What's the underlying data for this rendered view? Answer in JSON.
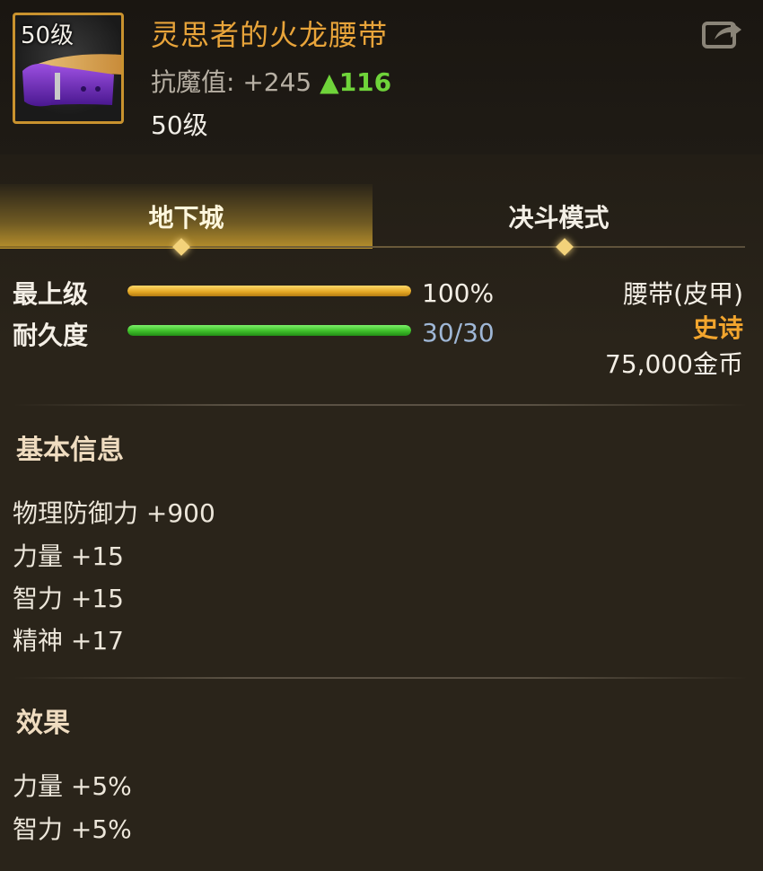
{
  "item": {
    "level_badge": "50级",
    "name": "灵思者的火龙腰带",
    "stat_label": "抗魔值:",
    "stat_value": "+245",
    "stat_gain_arrow": "▲",
    "stat_gain": "116",
    "required_level": "50级",
    "icon": "purple-belt-icon"
  },
  "header": {
    "share_icon": "share-icon"
  },
  "tabs": [
    {
      "label": "地下城",
      "active": true
    },
    {
      "label": "决斗模式",
      "active": false
    }
  ],
  "bars": {
    "top_level": {
      "label": "最上级",
      "value_text": "100%",
      "fill_fraction": 1.0
    },
    "durability": {
      "label": "耐久度",
      "value_text": "30/30",
      "fill_fraction": 1.0
    }
  },
  "info": {
    "type": "腰带(皮甲)",
    "rarity": "史诗",
    "price": "75,000金币"
  },
  "basic": {
    "title": "基本信息",
    "stats": [
      "物理防御力 +900",
      "力量 +15",
      "智力 +15",
      "精神 +17"
    ]
  },
  "effects": {
    "title": "效果",
    "stats": [
      "力量 +5%",
      "智力 +5%"
    ]
  },
  "colors": {
    "item_name": "#e8a43a",
    "rarity": "#f2a52e",
    "gain": "#6fd43a",
    "slot_border": "#c9922e"
  }
}
